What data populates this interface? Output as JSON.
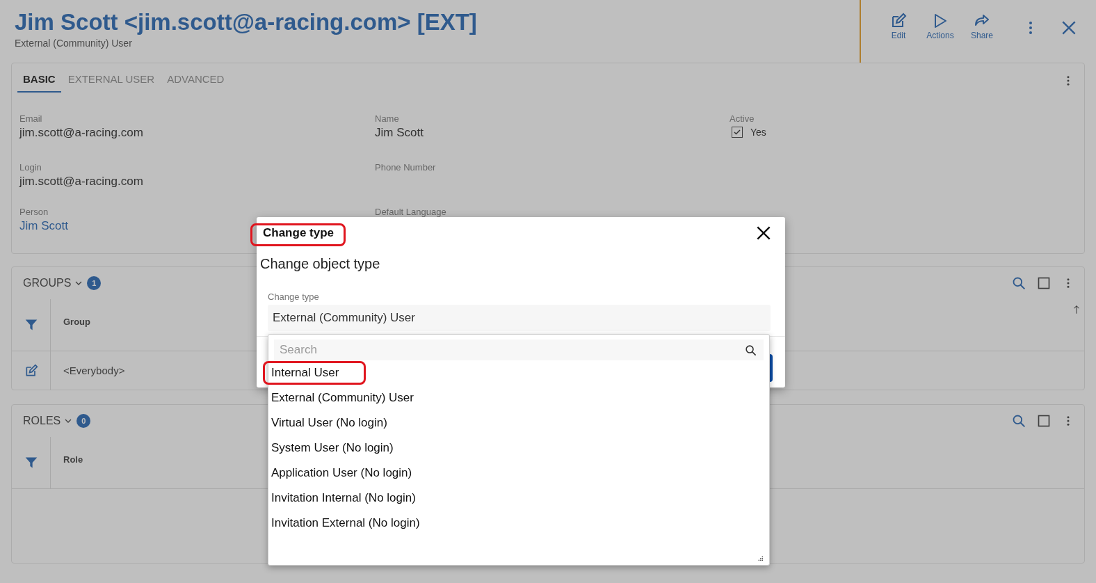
{
  "header": {
    "title": "Jim Scott <jim.scott@a-racing.com> [EXT]",
    "subtitle": "External (Community) User",
    "actions": [
      {
        "label": "Edit",
        "kind": "edit"
      },
      {
        "label": "Actions",
        "kind": "play"
      },
      {
        "label": "Share",
        "kind": "share"
      }
    ]
  },
  "tabs": [
    {
      "label": "BASIC",
      "selected": true
    },
    {
      "label": "EXTERNAL USER",
      "selected": false
    },
    {
      "label": "ADVANCED",
      "selected": false
    }
  ],
  "field_columns": [
    [
      {
        "label": "Email",
        "value": "jim.scott@a-racing.com",
        "kind": "text"
      },
      {
        "label": "Login",
        "value": "jim.scott@a-racing.com",
        "kind": "text"
      },
      {
        "label": "Person",
        "value": "Jim Scott",
        "kind": "link"
      }
    ],
    [
      {
        "label": "Name",
        "value": "Jim Scott",
        "kind": "text"
      },
      {
        "label": "Phone Number",
        "kind": "text"
      },
      {
        "label": "Default Language",
        "kind": "text"
      }
    ],
    [
      {
        "label": "Active",
        "value": "Yes",
        "kind": "checkbox",
        "checked": true
      }
    ]
  ],
  "sections": [
    {
      "title": "GROUPS",
      "count": "1",
      "column": "Group",
      "rows": [
        "<Everybody>"
      ]
    },
    {
      "title": "ROLES",
      "count": "0",
      "column": "Role"
    }
  ],
  "dialog": {
    "title": "Change type",
    "title_annotated": true,
    "heading": "Change object type",
    "field_label": "Change type",
    "value": "External (Community) User",
    "dropdown": {
      "placeholder": "Search",
      "options": [
        {
          "label": "Internal User",
          "annotated": true
        },
        {
          "label": "External (Community) User",
          "annotated": false
        },
        {
          "label": "Virtual User (No login)",
          "annotated": false
        },
        {
          "label": "System User (No login)",
          "annotated": false
        },
        {
          "label": "Application User (No login)",
          "annotated": false
        },
        {
          "label": "Invitation Internal (No login)",
          "annotated": false
        },
        {
          "label": "Invitation External (No login)",
          "annotated": false
        }
      ]
    }
  }
}
